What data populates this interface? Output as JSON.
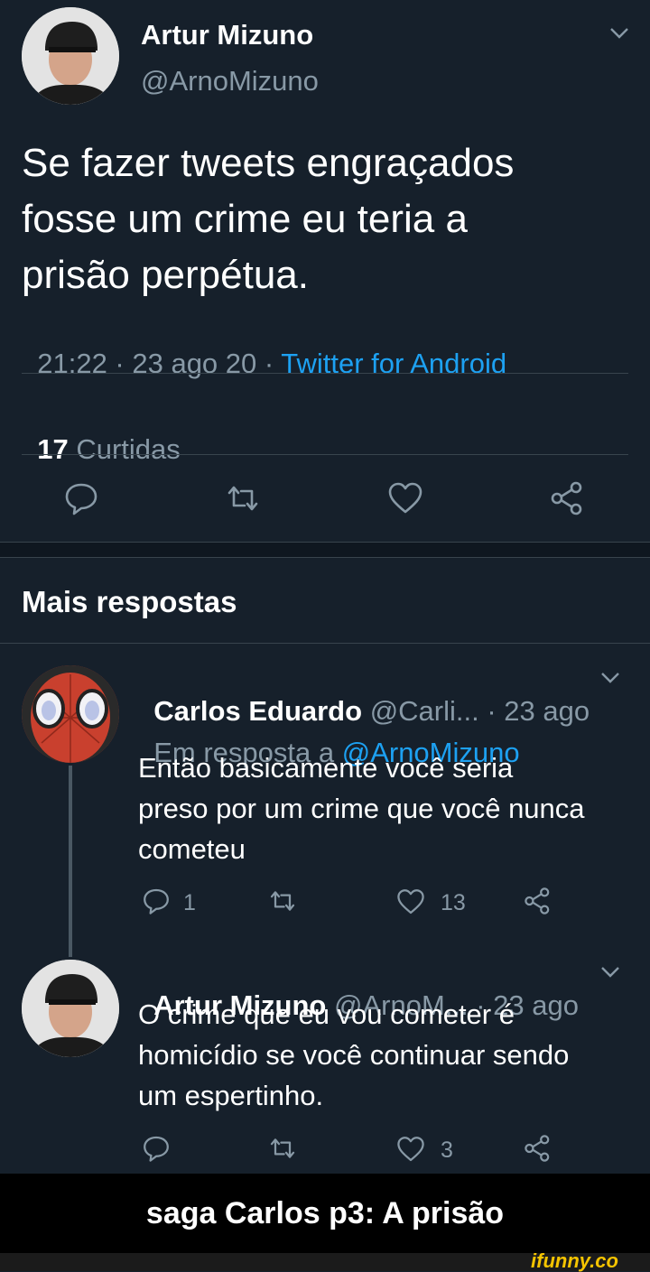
{
  "tweet": {
    "author_name": "Artur Mizuno",
    "author_handle": "@ArnoMizuno",
    "text_lines": [
      "Se fazer tweets engraçados",
      "fosse um crime eu teria a",
      "prisão perpétua."
    ],
    "time": "21:22 · 23 ago 20 · ",
    "source": "Twitter for Android",
    "likes_count": "17",
    "likes_label": "Curtidas"
  },
  "replies_header": "Mais respostas",
  "reply1": {
    "name": "Carlos Eduardo",
    "handle": "@Carli...",
    "date": " · 23 ago",
    "reply_prefix": "Em resposta a ",
    "reply_to": "@ArnoMizuno",
    "text_lines": [
      "Então basicamente você seria",
      "preso por um crime que você nunca",
      "cometeu"
    ],
    "reply_count": "1",
    "like_count": "13"
  },
  "reply2": {
    "name": "Artur Mizuno",
    "handle": "@ArnoM...",
    "date": " · 23 ago",
    "text_lines": [
      "O crime que eu vou cometer é",
      "homicídio se você continuar sendo",
      "um espertinho."
    ],
    "like_count": "3"
  },
  "caption": "saga Carlos p3: A prisão",
  "watermark": "ifunny.co",
  "colors": {
    "background": "#16202b",
    "accent": "#1da1f2",
    "muted": "#8899a6",
    "caption_bg": "#000000",
    "watermark": "#f5c400"
  },
  "icons": [
    "chevron-down-icon",
    "reply-icon",
    "retweet-icon",
    "like-icon",
    "share-icon"
  ]
}
